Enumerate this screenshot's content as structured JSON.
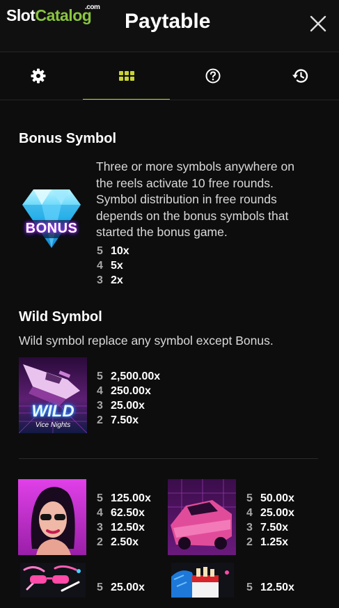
{
  "header": {
    "logo_slot": "Slot",
    "logo_catalog": "Catalog",
    "logo_com": ".com",
    "title": "Paytable"
  },
  "tabs": [
    {
      "icon": "gear-icon"
    },
    {
      "icon": "grid-icon",
      "active": true
    },
    {
      "icon": "help-circle-icon"
    },
    {
      "icon": "history-icon"
    }
  ],
  "bonus": {
    "heading": "Bonus Symbol",
    "description_lines": [
      "Three or more symbols anywhere on",
      "the reels activate 10 free rounds.",
      "Symbol distribution in free rounds",
      "depends on the bonus symbols that",
      "started the bonus game."
    ],
    "symbol_text": "BONUS",
    "payouts": [
      [
        "5",
        "10x"
      ],
      [
        "4",
        "5x"
      ],
      [
        "3",
        "2x"
      ]
    ]
  },
  "wild": {
    "heading": "Wild Symbol",
    "description": "Wild symbol replace any symbol except Bonus.",
    "symbol_text": "WILD",
    "symbol_subtext": "Vice Nights",
    "payouts": [
      [
        "5",
        "2,500.00x"
      ],
      [
        "4",
        "250.00x"
      ],
      [
        "3",
        "25.00x"
      ],
      [
        "2",
        "7.50x"
      ]
    ]
  },
  "symbols": [
    {
      "name": "woman",
      "payouts": [
        [
          "5",
          "125.00x"
        ],
        [
          "4",
          "62.50x"
        ],
        [
          "3",
          "12.50x"
        ],
        [
          "2",
          "2.50x"
        ]
      ]
    },
    {
      "name": "car",
      "payouts": [
        [
          "5",
          "50.00x"
        ],
        [
          "4",
          "25.00x"
        ],
        [
          "3",
          "7.50x"
        ],
        [
          "2",
          "1.25x"
        ]
      ]
    },
    {
      "name": "sunglasses",
      "payouts": [
        [
          "5",
          "25.00x"
        ]
      ]
    },
    {
      "name": "cigarettes",
      "payouts": [
        [
          "5",
          "12.50x"
        ]
      ]
    }
  ],
  "colors": {
    "accent": "#c8d235",
    "brand_green": "#8ac43f",
    "background": "#0d0d0d"
  }
}
